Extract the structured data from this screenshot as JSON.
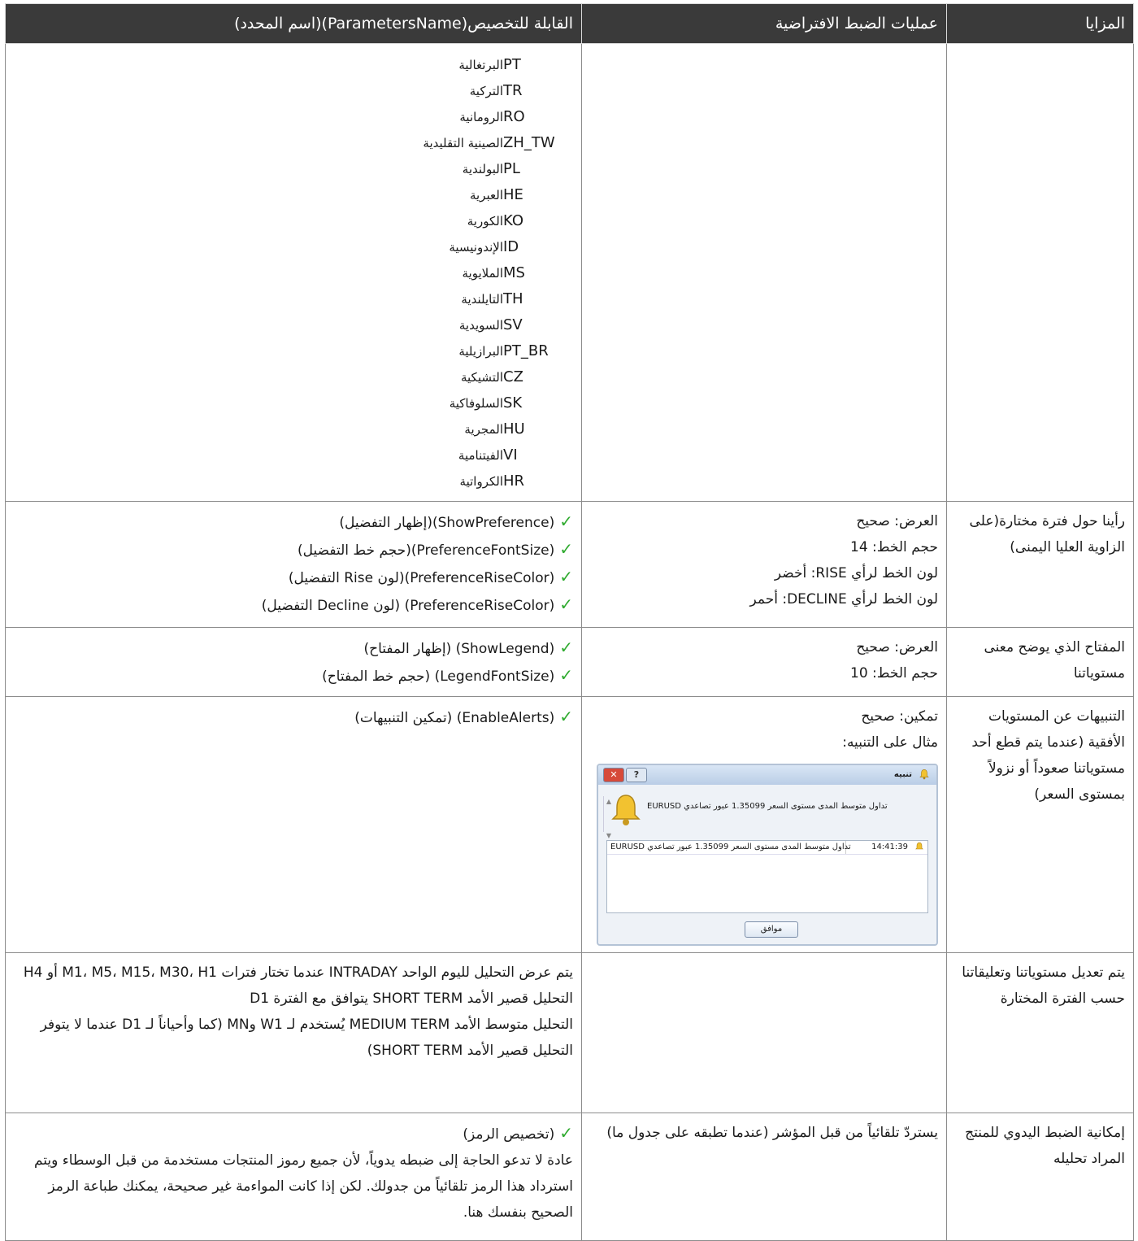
{
  "header": {
    "features": "المزايا",
    "defaults": "عمليات الضبط الافتراضية",
    "params": "القابلة للتخصيص(ParametersName)(اسم المحدد)"
  },
  "languages": [
    {
      "code": "PT",
      "name": "البرتغالية"
    },
    {
      "code": "TR",
      "name": "التركية"
    },
    {
      "code": "RO",
      "name": "الرومانية"
    },
    {
      "code": "ZH_TW",
      "name": "الصينية التقليدية"
    },
    {
      "code": "PL",
      "name": "البولندية"
    },
    {
      "code": "HE",
      "name": "العبرية"
    },
    {
      "code": "KO",
      "name": "الكورية"
    },
    {
      "code": "ID",
      "name": "الإندونيسية"
    },
    {
      "code": "MS",
      "name": "الملايوية"
    },
    {
      "code": "TH",
      "name": "التايلندية"
    },
    {
      "code": "SV",
      "name": "السويدية"
    },
    {
      "code": "PT_BR",
      "name": "البرازيلية"
    },
    {
      "code": "CZ",
      "name": "التشيكية"
    },
    {
      "code": "SK",
      "name": "السلوفاكية"
    },
    {
      "code": "HU",
      "name": "المجرية"
    },
    {
      "code": "VI",
      "name": "الفيتنامية"
    },
    {
      "code": "HR",
      "name": "الكرواتية"
    }
  ],
  "row_opinion": {
    "feature": "رأينا حول فترة مختارة(على الزاوية العليا اليمنى)",
    "defaults": [
      "العرض: صحيح",
      "حجم الخط: 14",
      "لون الخط لرأي RISE: أخضر",
      "لون الخط لرأي DECLINE: أحمر"
    ],
    "params": [
      "(ShowPreference)(إظهار التفضيل)",
      "(PreferenceFontSize)(حجم خط التفضيل)",
      "(PreferenceRiseColor)(لون Rise التفضيل)",
      "(PreferenceRiseColor) (لون Decline التفضيل)"
    ]
  },
  "row_legend": {
    "feature": "المفتاح الذي يوضح معنى مستوياتنا",
    "defaults": [
      "العرض: صحيح",
      "حجم الخط: 10"
    ],
    "params": [
      "(ShowLegend) (إظهار المفتاح)",
      "(LegendFontSize) (حجم خط المفتاح)"
    ]
  },
  "row_alerts": {
    "feature": "التنبيهات عن المستويات الأفقية (عندما يتم قطع أحد مستوياتنا صعوداً أو نزولاً بمستوى السعر)",
    "defaults": [
      "تمكين: صحيح",
      "مثال على التنبيه:"
    ],
    "params": [
      "(EnableAlerts) (تمكين التنبيهات)"
    ],
    "dialog": {
      "title": "تنبيه",
      "help": "?",
      "close": "✕",
      "message": "تداول متوسط المدى مستوى السعر 1.35099 عبور تصاعدي EURUSD",
      "list_time": "14:41:39",
      "list_message": "تداول متوسط المدى مستوى السعر 1.35099 عبور تصاعدي EURUSD",
      "ok": "موافق"
    }
  },
  "row_timeframe": {
    "feature": "يتم تعديل مستوياتنا وتعليقاتنا حسب الفترة المختارة",
    "text": "يتم عرض التحليل لليوم الواحد INTRADAY عندما تختار فترات M1، M5، M15، M30، H1 أو H4\nالتحليل قصير الأمد SHORT TERM يتوافق مع الفترة D1\nالتحليل متوسط الأمد MEDIUM TERM يُستخدم لـ W1 وMN (كما وأحياناً لـ D1 عندما لا يتوفر التحليل قصير الأمد SHORT TERM)"
  },
  "row_symbol": {
    "feature": "إمكانية الضبط اليدوي للمنتج المراد تحليله",
    "defaults": "يستردّ تلقائياً من قبل المؤشر (عندما تطبقه على جدول ما)",
    "param": "(تخصيص الرمز)",
    "text": "عادة لا تدعو الحاجة إلى ضبطه يدوياً، لأن جميع رموز المنتجات مستخدمة من قبل الوسطاء ويتم استرداد هذا الرمز تلقائياً من جدولك. لكن إذا كانت المواءمة غير صحيحة، يمكنك طباعة الرمز الصحيح بنفسك هنا."
  },
  "colors": {
    "header_bg": "#3a3a3a",
    "check": "#2eaa2e",
    "border": "#8c8c8c"
  },
  "icons": [
    "check-icon",
    "bell-icon",
    "close-icon",
    "help-icon"
  ]
}
